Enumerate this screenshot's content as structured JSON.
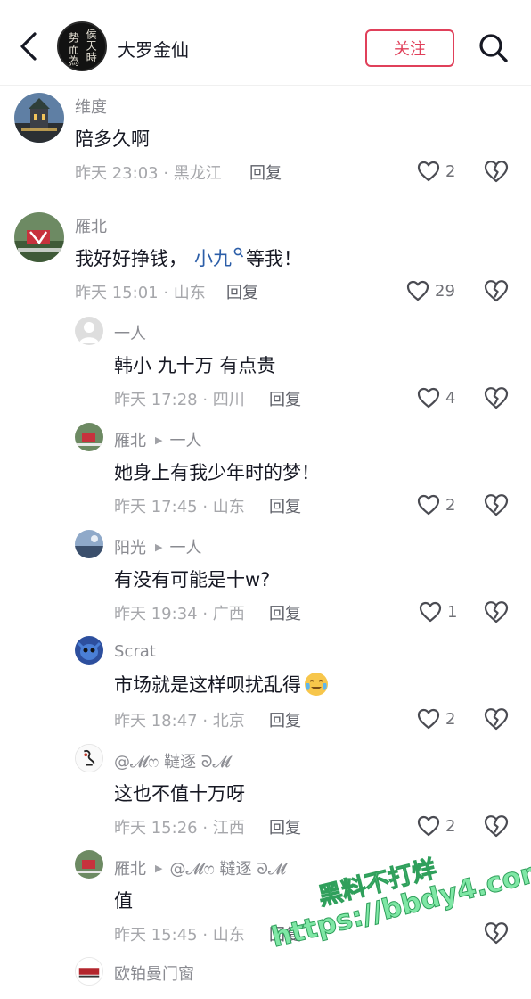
{
  "header": {
    "title": "大罗金仙",
    "follow_label": "关注",
    "avatar_text": [
      "侯",
      "天",
      "時",
      "势",
      "而",
      "為"
    ]
  },
  "colors": {
    "accent": "#e0405a",
    "mention": "#2c5ea8",
    "watermark": "#7fe7a5"
  },
  "comments": [
    {
      "user": "维度",
      "text": "陪多久啊",
      "meta": "昨天 23:03 · 黑龙江",
      "reply": "回复",
      "likes": "2"
    },
    {
      "user": "雁北",
      "text_before": "我好好挣钱，",
      "mention": "小九",
      "text_after": "等我！",
      "meta": "昨天 15:01 · 山东",
      "reply": "回复",
      "likes": "29"
    }
  ],
  "replies": [
    {
      "user": "一人",
      "text": "韩小  九十万  有点贵",
      "meta": "昨天 17:28 · 四川",
      "reply": "回复",
      "likes": "4"
    },
    {
      "user": "雁北",
      "to": "一人",
      "text": "她身上有我少年时的梦！",
      "meta": "昨天 17:45 · 山东",
      "reply": "回复",
      "likes": "2"
    },
    {
      "user": "阳光",
      "to": "一人",
      "text": "有没有可能是十w?",
      "meta": "昨天 19:34 · 广西",
      "reply": "回复",
      "likes": "1"
    },
    {
      "user": "Scrat",
      "text": "市场就是这样呗扰乱得",
      "meta": "昨天 18:47 · 北京",
      "reply": "回复",
      "likes": "2"
    },
    {
      "user": "@𝓜ෆ 韃逐 ᘐ𝓜",
      "text": "这也不值十万呀",
      "meta": "昨天 15:26 · 江西",
      "reply": "回复",
      "likes": "2"
    },
    {
      "user": "雁北",
      "to": "@𝓜ෆ 韃逐 ᘐ𝓜",
      "text": "值",
      "meta": "昨天 15:45 · 山东",
      "reply": "回复",
      "likes": ""
    },
    {
      "user": "欧铂曼门窗"
    }
  ],
  "watermark": {
    "line1": "黑料不打烊",
    "line2": "https://bbdy4.com"
  }
}
